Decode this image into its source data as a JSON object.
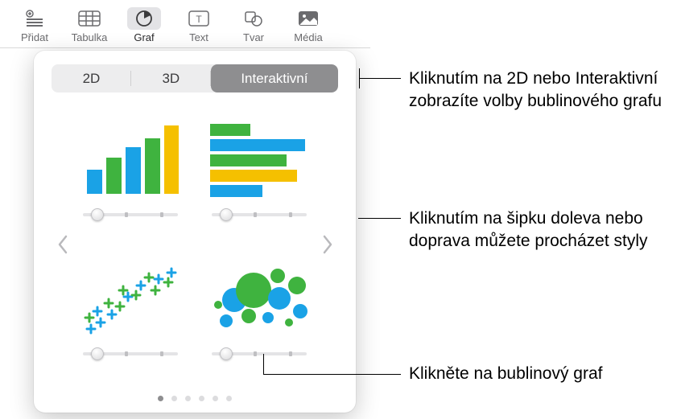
{
  "toolbar": {
    "items": [
      {
        "label": "Přidat"
      },
      {
        "label": "Tabulka"
      },
      {
        "label": "Graf"
      },
      {
        "label": "Text"
      },
      {
        "label": "Tvar"
      },
      {
        "label": "Média"
      }
    ]
  },
  "popover": {
    "tabs": {
      "tab2d": "2D",
      "tab3d": "3D",
      "tabInteractive": "Interaktivní"
    },
    "charts": [
      {
        "name": "column-chart-thumb"
      },
      {
        "name": "bar-chart-thumb"
      },
      {
        "name": "scatter-chart-thumb"
      },
      {
        "name": "bubble-chart-thumb"
      }
    ],
    "page_count": 6,
    "active_page": 0
  },
  "callouts": {
    "c1": "Kliknutím na 2D nebo Interaktivní zobrazíte volby bublinového grafu",
    "c2": "Kliknutím na šipku doleva nebo doprava můžete procházet styly",
    "c3": "Klikněte na bublinový graf"
  },
  "colors": {
    "blue": "#1aa2e6",
    "green": "#3fb33f",
    "yellow": "#f5c000"
  }
}
